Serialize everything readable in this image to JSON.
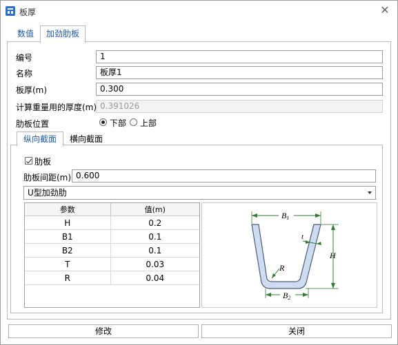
{
  "window": {
    "title": "板厚"
  },
  "tabs": [
    {
      "label": "数值"
    },
    {
      "label": "加劲肋板"
    }
  ],
  "fields": {
    "number": {
      "label": "编号",
      "value": "1"
    },
    "name": {
      "label": "名称",
      "value": "板厚1"
    },
    "thickness": {
      "label": "板厚(m)",
      "value": "0.300"
    },
    "weight_thickness": {
      "label": "计算重量用的厚度(m)",
      "value": "0.391026"
    }
  },
  "rib_position": {
    "label": "肋板位置",
    "options": [
      {
        "label": "下部",
        "selected": true
      },
      {
        "label": "上部",
        "selected": false
      }
    ]
  },
  "inner_tabs": [
    {
      "label": "纵向截面"
    },
    {
      "label": "横向截面"
    }
  ],
  "rib": {
    "checkbox_label": "肋板",
    "checked": true,
    "spacing_label": "肋板间距(m)",
    "spacing_value": "0.600",
    "type_value": "U型加劲肋"
  },
  "param_table": {
    "headers": [
      "参数",
      "值(m)"
    ],
    "rows": [
      {
        "param": "H",
        "value": "0.2"
      },
      {
        "param": "B1",
        "value": "0.1"
      },
      {
        "param": "B2",
        "value": "0.1"
      },
      {
        "param": "T",
        "value": "0.03"
      },
      {
        "param": "R",
        "value": "0.04"
      }
    ]
  },
  "diagram_labels": {
    "b1": "B",
    "b1_sub": "1",
    "b2": "B",
    "b2_sub": "2",
    "h": "H",
    "t": "t",
    "r": "R"
  },
  "buttons": {
    "modify": "修改",
    "close": "关闭"
  },
  "colors": {
    "accent": "#1e5aa8",
    "dimension": "#2f7a2f",
    "profile_fill": "#cfdcf0"
  }
}
